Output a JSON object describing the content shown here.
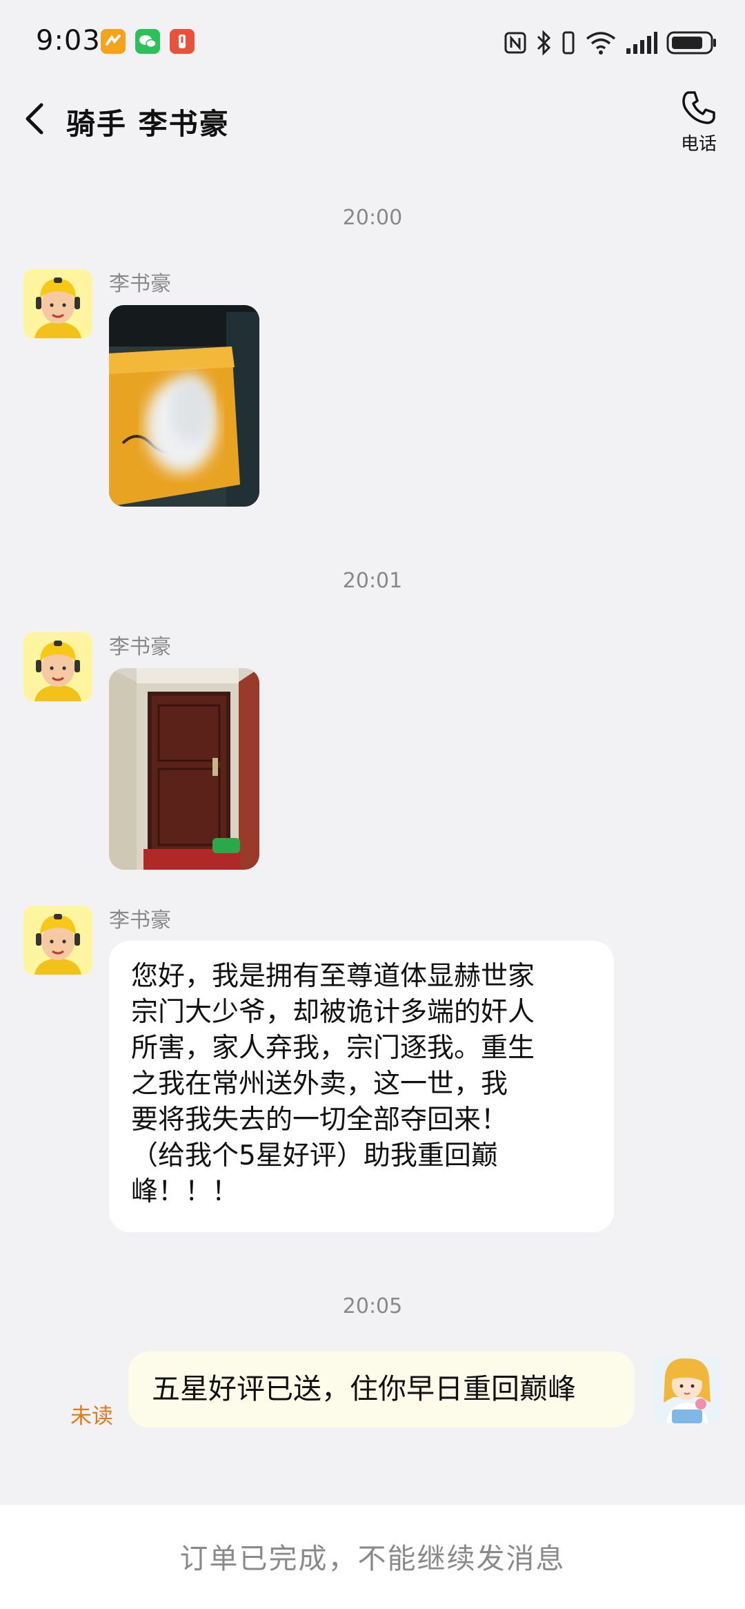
{
  "status_bar": {
    "time": "9:03",
    "app_icons": [
      {
        "icon": "meituan-app-icon",
        "color": "#f5a31a"
      },
      {
        "icon": "wechat-app-icon",
        "color": "#2dc15a"
      },
      {
        "icon": "alert-app-icon",
        "color": "#e8513b"
      }
    ],
    "system_icons": [
      "nfc-icon",
      "bluetooth-icon",
      "vibrate-icon",
      "wifi-icon",
      "signal-icon",
      "battery-icon"
    ]
  },
  "header": {
    "title": "骑手 李书豪",
    "phone_label": "电话"
  },
  "messages": [
    {
      "time": "20:00",
      "sender": "李书豪",
      "type": "image",
      "content": "delivery-photo-package"
    },
    {
      "time": "20:01",
      "sender": "李书豪",
      "type": "image",
      "content": "delivery-photo-door"
    },
    {
      "sender": "李书豪",
      "type": "text",
      "text": "您好，我是拥有至尊道体显赫世家\n宗门大少爷，却被诡计多端的奸人\n所害，家人弃我，宗门逐我。重生\n之我在常州送外卖，这一世，我\n要将我失去的一切全部夺回来！\n（给我个5星好评）助我重回巅\n峰！！！"
    },
    {
      "time": "20:05",
      "sender": "me",
      "type": "text",
      "text": "五星好评已送，住你早日重回巅峰",
      "status": "未读"
    }
  ],
  "footer": {
    "notice": "订单已完成，不能继续发消息"
  },
  "colors": {
    "background": "#f2f2f4",
    "incoming_bubble": "#ffffff",
    "outgoing_bubble": "#fdfcea",
    "unread": "#e07a1a",
    "timestamp": "#888888"
  }
}
